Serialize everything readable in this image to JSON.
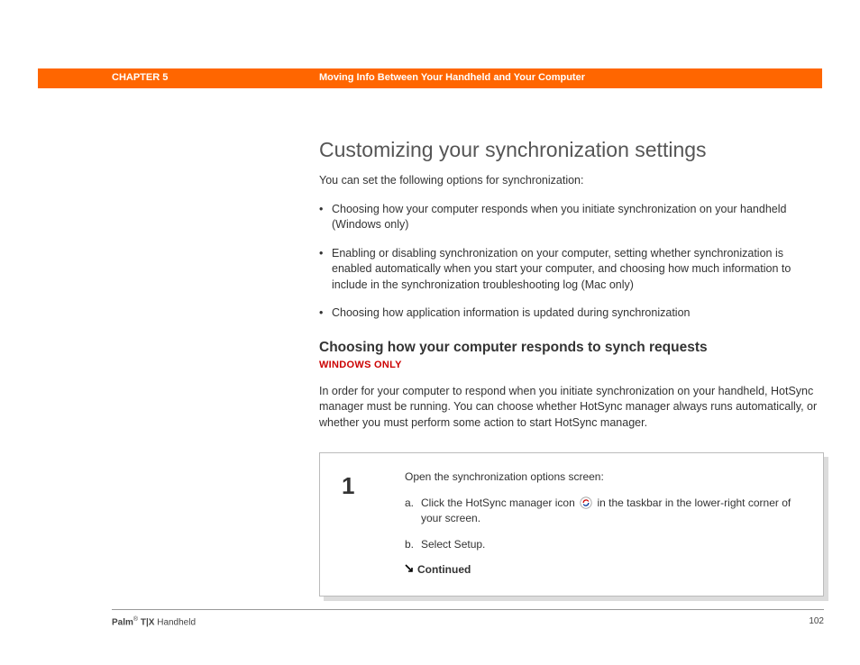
{
  "header": {
    "chapter": "CHAPTER 5",
    "title": "Moving Info Between Your Handheld and Your Computer"
  },
  "main": {
    "heading": "Customizing your synchronization settings",
    "intro": "You can set the following options for synchronization:",
    "bullets": [
      "Choosing how your computer responds when you initiate synchronization on your handheld (Windows only)",
      "Enabling or disabling synchronization on your computer, setting whether synchronization is enabled automatically when you start your computer, and choosing how much information to include in the synchronization troubleshooting log (Mac only)",
      "Choosing how application information is updated during synchronization"
    ],
    "section": {
      "heading": "Choosing how your computer responds to synch requests",
      "tag": "WINDOWS ONLY",
      "body": "In order for your computer to respond when you initiate synchronization on your handheld, HotSync manager must be running. You can choose whether HotSync manager always runs automatically, or whether you must perform some action to start HotSync manager."
    },
    "step": {
      "number": "1",
      "lead": "Open the synchronization options screen:",
      "a_letter": "a.",
      "a_before": "Click the HotSync manager icon",
      "a_after": "in the taskbar in the lower-right corner of your screen.",
      "b_letter": "b.",
      "b_text": "Select Setup.",
      "continued": "Continued"
    }
  },
  "footer": {
    "product_bold": "Palm",
    "product_reg": "®",
    "product_model": " T|X",
    "product_suffix": " Handheld",
    "page": "102"
  }
}
